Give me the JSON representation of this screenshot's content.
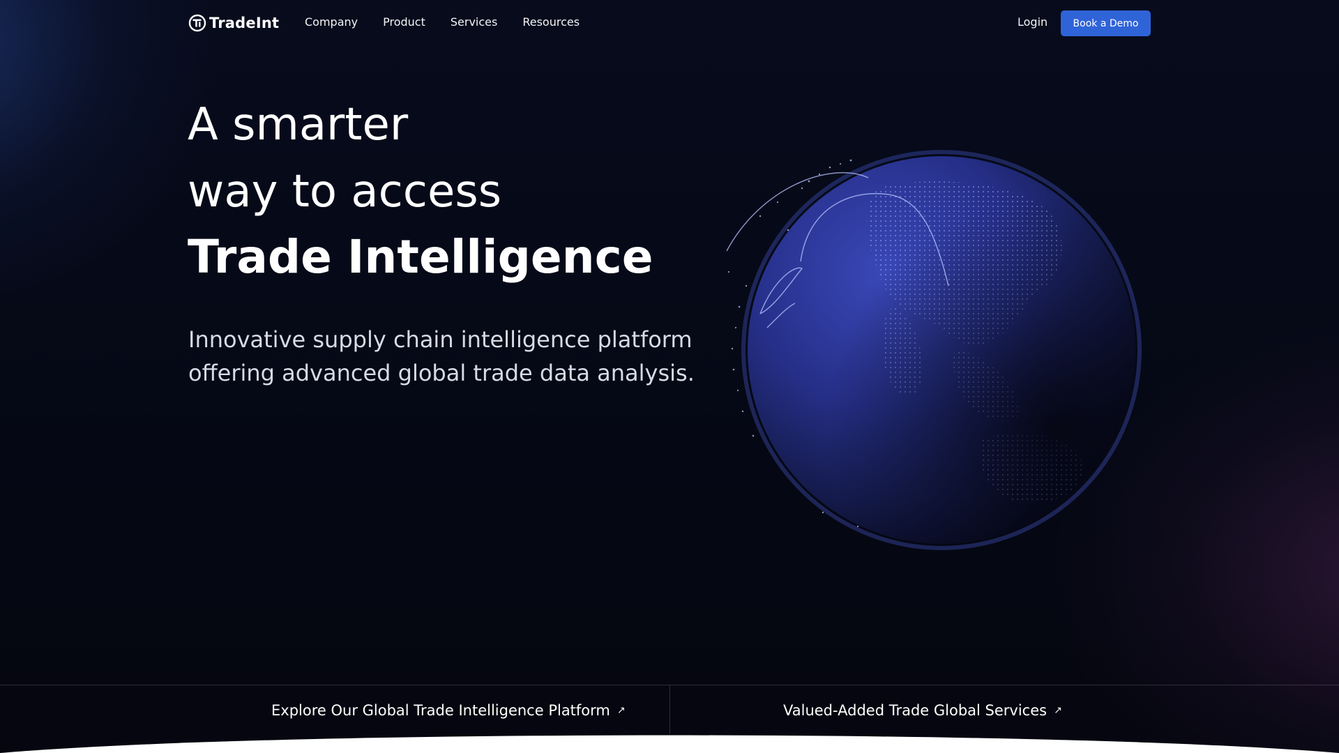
{
  "brand": {
    "name": "TradeInt",
    "logo_icon": "ti-monogram-logo"
  },
  "nav": {
    "items": [
      {
        "label": "Company"
      },
      {
        "label": "Product"
      },
      {
        "label": "Services"
      },
      {
        "label": "Resources"
      }
    ],
    "login": "Login",
    "cta": "Book a Demo"
  },
  "hero": {
    "line1": "A smarter",
    "line2": "way to access",
    "line3_word1": "Trade",
    "line3_word2": "Intelligence",
    "subtitle_line1": "Innovative supply chain intelligence platform",
    "subtitle_line2": "offering advanced global trade data analysis."
  },
  "bottom_links": [
    {
      "label": "Explore Our Global Trade Intelligence Platform",
      "icon": "arrow-up-right-icon"
    },
    {
      "label": "Valued-Added Trade Global Services",
      "icon": "arrow-up-right-icon"
    }
  ],
  "colors": {
    "background": "#050814",
    "accent": "#2f63d8",
    "globe": "#2a3590",
    "text_muted": "#d7dbe6"
  }
}
